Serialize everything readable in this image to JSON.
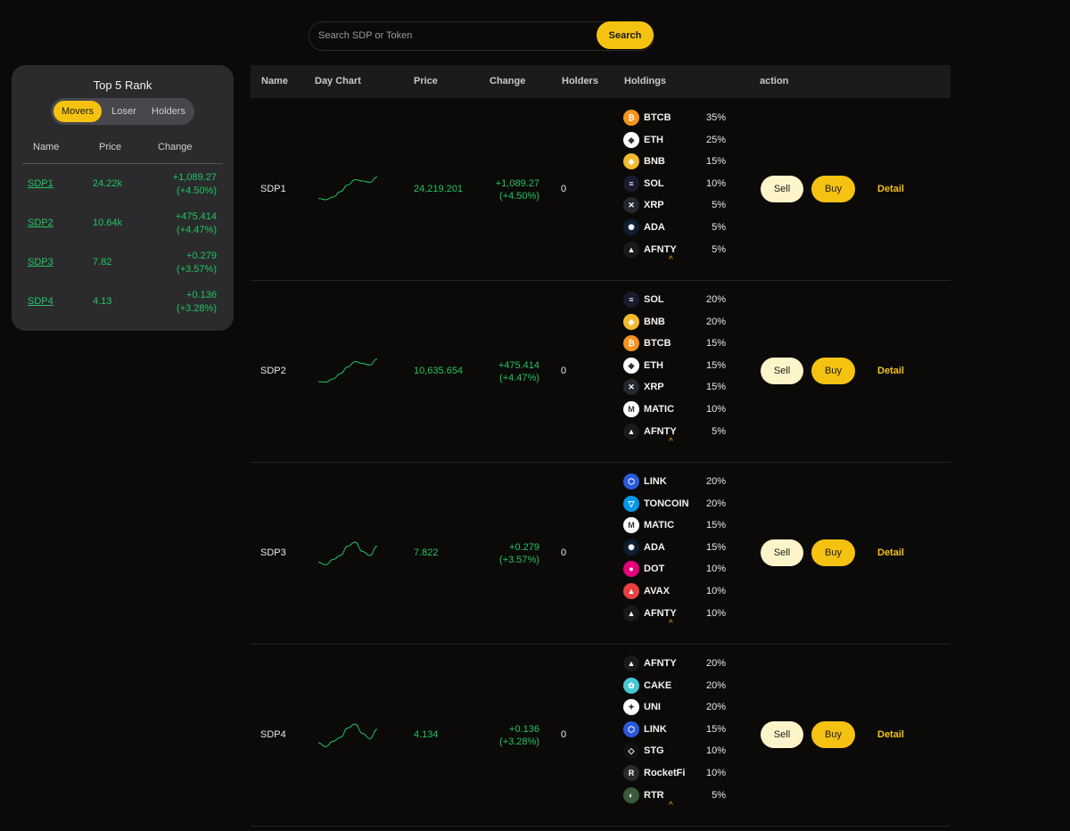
{
  "search": {
    "placeholder": "Search SDP or Token",
    "button": "Search"
  },
  "rank": {
    "title": "Top 5 Rank",
    "tabs": [
      "Movers",
      "Loser",
      "Holders"
    ],
    "active_tab": "Movers",
    "headers": {
      "name": "Name",
      "price": "Price",
      "change": "Change"
    },
    "rows": [
      {
        "name": "SDP1",
        "price": "24.22k",
        "change": "+1,089.27",
        "pct": "(+4.50%)"
      },
      {
        "name": "SDP2",
        "price": "10.64k",
        "change": "+475.414",
        "pct": "(+4.47%)"
      },
      {
        "name": "SDP3",
        "price": "7.82",
        "change": "+0.279",
        "pct": "(+3.57%)"
      },
      {
        "name": "SDP4",
        "price": "4.13",
        "change": "+0.136",
        "pct": "(+3.28%)"
      }
    ]
  },
  "table": {
    "headers": [
      "Name",
      "Day Chart",
      "Price",
      "Change",
      "Holders",
      "Holdings",
      "action"
    ],
    "sell_label": "Sell",
    "buy_label": "Buy",
    "detail_label": "Detail",
    "chevron": "^",
    "rows": [
      {
        "name": "SDP1",
        "price": "24,219.201",
        "change": "+1,089.27",
        "pct": "(+4.50%)",
        "holders": "0",
        "spark": [
          0.15,
          0.1,
          0.2,
          0.4,
          0.65,
          0.85,
          0.8,
          0.75,
          0.95
        ],
        "holdings": [
          {
            "token": "BTCB",
            "pct": "35%",
            "icon": "btc-icon",
            "color": "#f7931a",
            "glyph": "₿"
          },
          {
            "token": "ETH",
            "pct": "25%",
            "icon": "eth-icon",
            "color": "#ffffff",
            "glyph": "◆"
          },
          {
            "token": "BNB",
            "pct": "15%",
            "icon": "bnb-icon",
            "color": "#f3ba2f",
            "glyph": "◈"
          },
          {
            "token": "SOL",
            "pct": "10%",
            "icon": "sol-icon",
            "color": "#1a1a2e",
            "glyph": "≡"
          },
          {
            "token": "XRP",
            "pct": "5%",
            "icon": "xrp-icon",
            "color": "#23292f",
            "glyph": "✕"
          },
          {
            "token": "ADA",
            "pct": "5%",
            "icon": "ada-icon",
            "color": "#0d1e30",
            "glyph": "✺"
          },
          {
            "token": "AFNTY",
            "pct": "5%",
            "icon": "afnty-icon",
            "color": "#1a1a1a",
            "glyph": "▲"
          }
        ]
      },
      {
        "name": "SDP2",
        "price": "10,635.654",
        "change": "+475.414",
        "pct": "(+4.47%)",
        "holders": "0",
        "spark": [
          0.1,
          0.08,
          0.2,
          0.4,
          0.65,
          0.85,
          0.78,
          0.72,
          0.95
        ],
        "holdings": [
          {
            "token": "SOL",
            "pct": "20%",
            "icon": "sol-icon",
            "color": "#1a1a2e",
            "glyph": "≡"
          },
          {
            "token": "BNB",
            "pct": "20%",
            "icon": "bnb-icon",
            "color": "#f3ba2f",
            "glyph": "◈"
          },
          {
            "token": "BTCB",
            "pct": "15%",
            "icon": "btc-icon",
            "color": "#f7931a",
            "glyph": "₿"
          },
          {
            "token": "ETH",
            "pct": "15%",
            "icon": "eth-icon",
            "color": "#ffffff",
            "glyph": "◆"
          },
          {
            "token": "XRP",
            "pct": "15%",
            "icon": "xrp-icon",
            "color": "#23292f",
            "glyph": "✕"
          },
          {
            "token": "MATIC",
            "pct": "10%",
            "icon": "matic-icon",
            "color": "#ffffff",
            "glyph": "M"
          },
          {
            "token": "AFNTY",
            "pct": "5%",
            "icon": "afnty-icon",
            "color": "#1a1a1a",
            "glyph": "▲"
          }
        ]
      },
      {
        "name": "SDP3",
        "price": "7.822",
        "change": "+0.279",
        "pct": "(+3.57%)",
        "holders": "0",
        "spark": [
          0.15,
          0.05,
          0.25,
          0.4,
          0.75,
          0.9,
          0.55,
          0.4,
          0.75
        ],
        "holdings": [
          {
            "token": "LINK",
            "pct": "20%",
            "icon": "link-icon",
            "color": "#2a5ada",
            "glyph": "⬡"
          },
          {
            "token": "TONCOIN",
            "pct": "20%",
            "icon": "ton-icon",
            "color": "#0098ea",
            "glyph": "▽"
          },
          {
            "token": "MATIC",
            "pct": "15%",
            "icon": "matic-icon",
            "color": "#ffffff",
            "glyph": "M"
          },
          {
            "token": "ADA",
            "pct": "15%",
            "icon": "ada-icon",
            "color": "#0d1e30",
            "glyph": "✺"
          },
          {
            "token": "DOT",
            "pct": "10%",
            "icon": "dot-icon",
            "color": "#e6007a",
            "glyph": "●"
          },
          {
            "token": "AVAX",
            "pct": "10%",
            "icon": "avax-icon",
            "color": "#e84142",
            "glyph": "▲"
          },
          {
            "token": "AFNTY",
            "pct": "10%",
            "icon": "afnty-icon",
            "color": "#1a1a1a",
            "glyph": "▲"
          }
        ]
      },
      {
        "name": "SDP4",
        "price": "4.134",
        "change": "+0.136",
        "pct": "(+3.28%)",
        "holders": "0",
        "spark": [
          0.2,
          0.05,
          0.25,
          0.4,
          0.75,
          0.9,
          0.55,
          0.35,
          0.7
        ],
        "holdings": [
          {
            "token": "AFNTY",
            "pct": "20%",
            "icon": "afnty-icon",
            "color": "#1a1a1a",
            "glyph": "▲"
          },
          {
            "token": "CAKE",
            "pct": "20%",
            "icon": "cake-icon",
            "color": "#45c7d4",
            "glyph": "✿"
          },
          {
            "token": "UNI",
            "pct": "20%",
            "icon": "uni-icon",
            "color": "#ffffff",
            "glyph": "✦"
          },
          {
            "token": "LINK",
            "pct": "15%",
            "icon": "link-icon",
            "color": "#2a5ada",
            "glyph": "⬡"
          },
          {
            "token": "STG",
            "pct": "10%",
            "icon": "stg-icon",
            "color": "#111111",
            "glyph": "◇"
          },
          {
            "token": "RocketFi",
            "pct": "10%",
            "icon": "rocketfi-icon",
            "color": "#2a2a2a",
            "glyph": "R"
          },
          {
            "token": "RTR",
            "pct": "5%",
            "icon": "rtr-icon",
            "color": "#3a5a3a",
            "glyph": "◐"
          }
        ]
      }
    ]
  }
}
